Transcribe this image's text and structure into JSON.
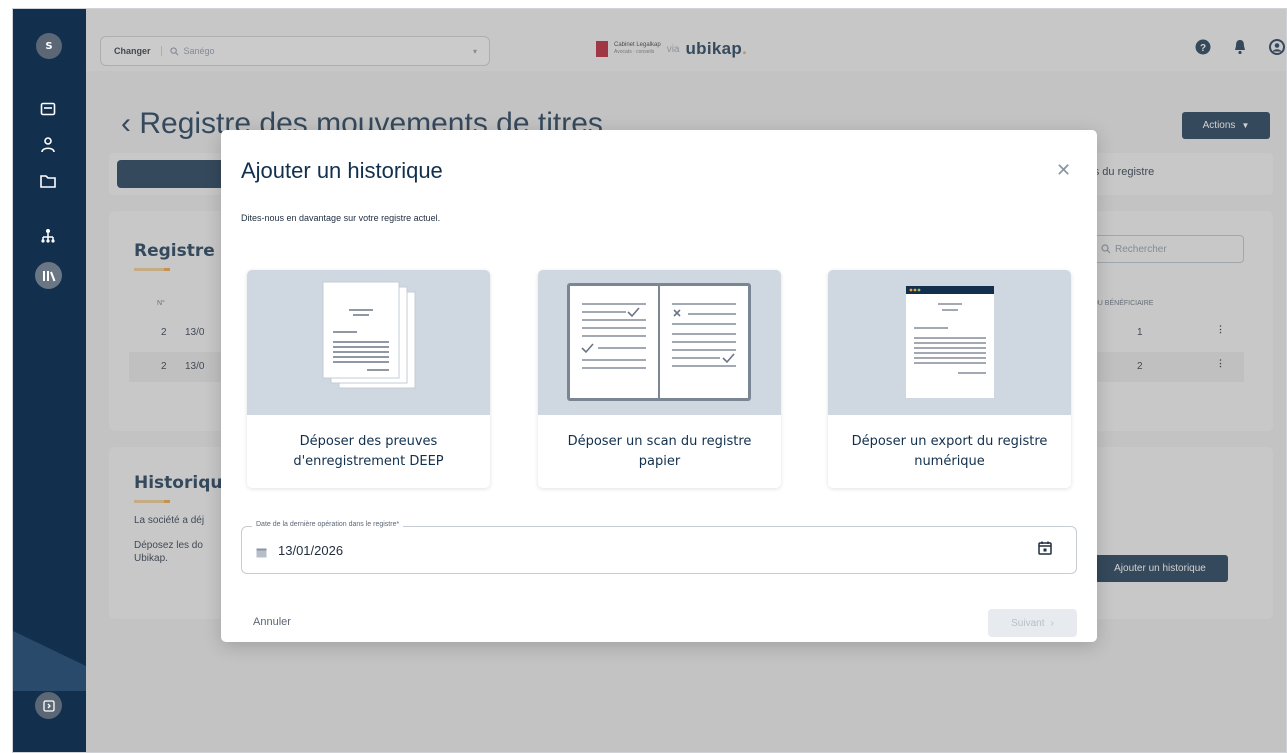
{
  "sidebar": {
    "avatar": "S",
    "items": [
      {
        "icon": "home-icon"
      },
      {
        "icon": "person-icon"
      },
      {
        "icon": "folder-icon"
      },
      {
        "icon": "org-chart-icon"
      },
      {
        "icon": "library-icon",
        "active": true
      }
    ],
    "bottom_icon": "collapse-icon"
  },
  "topbar": {
    "changer_label": "Changer",
    "company_value": "Sanégo",
    "brand_partner": "Cabinet Legalkap",
    "brand_partner_sub": "Avocats · conseils",
    "brand_via": "via",
    "brand_name": "ubikap",
    "brand_dot": ".",
    "icons": [
      "help-icon",
      "bell-icon",
      "account-icon"
    ]
  },
  "page": {
    "back": "‹",
    "title": "Registre des mouvements de titres",
    "actions_label": "Actions",
    "tab_right_label": "rts du registre",
    "card1": {
      "title": "Registre d",
      "search_placeholder": "Rechercher",
      "col_no": "N°",
      "col_beneficiary": "° DU BÉNÉFICIAIRE",
      "rows": [
        {
          "no": "2",
          "date": "13/0",
          "benef": "1"
        },
        {
          "no": "2",
          "date": "13/0",
          "benef": "2"
        }
      ]
    },
    "card2": {
      "title": "Historique",
      "line1": "La société a déj",
      "line2": "Déposez les do",
      "line3": "Ubikap.",
      "button": "Ajouter un historique"
    }
  },
  "modal": {
    "title": "Ajouter un historique",
    "subtitle": "Dites-nous en davantage sur votre registre actuel.",
    "options": [
      {
        "label": "Déposer des preuves d'enregistrement DEEP"
      },
      {
        "label": "Déposer un scan du registre papier"
      },
      {
        "label": "Déposer un export du registre numérique"
      }
    ],
    "date_legend": "Date de la dernière opération dans le registre*",
    "date_value": "13/01/2026",
    "cancel_label": "Annuler",
    "next_label": "Suivant",
    "next_chevron": "›"
  },
  "colors": {
    "navy": "#12304e",
    "accent": "#f0a03a",
    "illustration_bg": "#cfd8e0"
  }
}
